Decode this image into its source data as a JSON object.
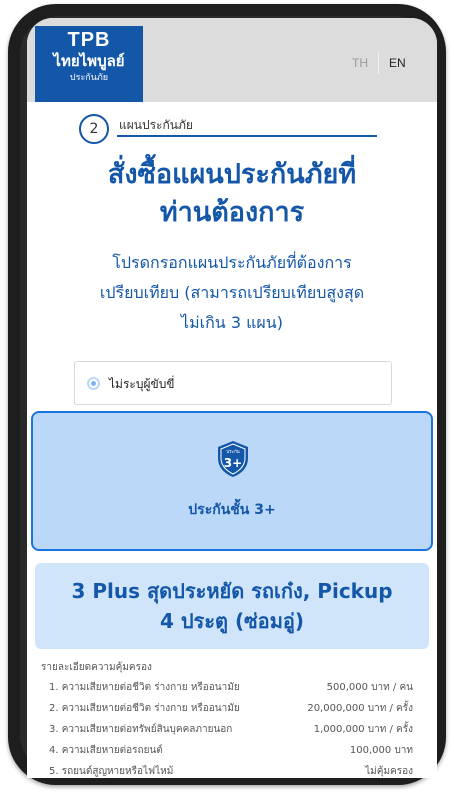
{
  "header": {
    "logo_line1": "TPB",
    "logo_line2": "ไทยไพบูลย์",
    "logo_line3": "ประกันภัย",
    "lang_th": "TH",
    "lang_en": "EN"
  },
  "step": {
    "number": "2",
    "label": "แผนประกันภัย"
  },
  "title_lines": [
    "สั่งซื้อแผนประกันภัยที่",
    "ท่านต้องการ"
  ],
  "description_lines": [
    "โปรดกรอกแผนประกันภัยที่ต้องการ",
    "เปรียบเทียบ (สามารถเปรียบเทียบสูงสุด",
    "ไม่เกิน 3 แผน)"
  ],
  "driver_option": {
    "label": "ไม่ระบุผู้ขับขี่",
    "selected": true
  },
  "plan_card": {
    "badge_top": "ประกัน",
    "badge_main": "3+",
    "label": "ประกันชั้น 3+"
  },
  "package": {
    "title_lines": [
      "3 Plus สุดประหยัด รถเก๋ง, Pickup",
      "4 ประตู (ซ่อมอู่)"
    ]
  },
  "coverage": {
    "title": "รายละเอียดความคุ้มครอง",
    "rows": [
      {
        "name": "1. ความเสียหายต่อชีวิต ร่างกาย หรืออนามัย",
        "value": "500,000 บาท / คน"
      },
      {
        "name": "2. ความเสียหายต่อชีวิต ร่างกาย หรืออนามัย",
        "value": "20,000,000 บาท / ครั้ง"
      },
      {
        "name": "3. ความเสียหายต่อทรัพย์สินบุคคลภายนอก",
        "value": "1,000,000 บาท / ครั้ง"
      },
      {
        "name": "4. ความเสียหายต่อรถยนต์",
        "value": "100,000 บาท"
      },
      {
        "name": "5. รถยนต์สูญหายหรือไฟไหม้",
        "value": "ไม่คุ้มครอง"
      }
    ]
  },
  "colors": {
    "brand_blue": "#1457a8",
    "card_bg": "#bcd8f8",
    "card_border": "#1a75e0",
    "package_bg": "#d0e4fa"
  }
}
